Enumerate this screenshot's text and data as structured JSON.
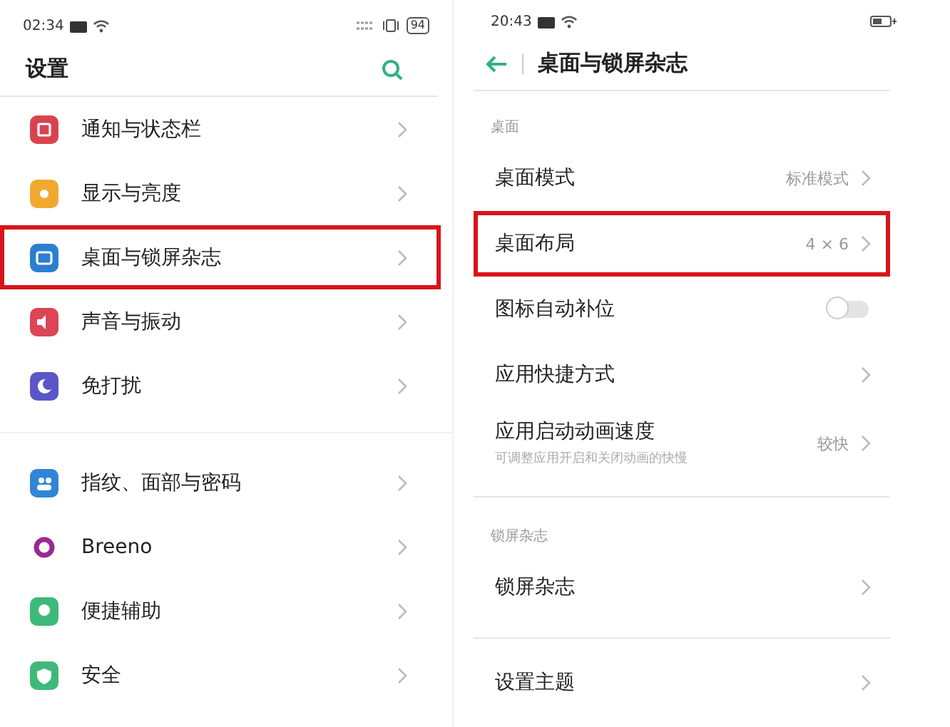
{
  "left": {
    "status_bar": {
      "time": "02:34",
      "battery": "94"
    },
    "title": "设置",
    "groups": [
      {
        "items": [
          {
            "label": "通知与状态栏",
            "kind": "notification",
            "color": "#d9434f",
            "highlighted": false
          },
          {
            "label": "显示与亮度",
            "kind": "sun",
            "color": "#f0a830",
            "highlighted": false
          },
          {
            "label": "桌面与锁屏杂志",
            "kind": "desktop",
            "color": "#2b7fd0",
            "highlighted": true
          },
          {
            "label": "声音与振动",
            "kind": "sound",
            "color": "#dd4455",
            "highlighted": false
          },
          {
            "label": "免打扰",
            "kind": "moon",
            "color": "#5a56c8",
            "highlighted": false
          }
        ]
      },
      {
        "items": [
          {
            "label": "指纹、面部与密码",
            "kind": "people",
            "color": "#2f86d6",
            "highlighted": false
          },
          {
            "label": "Breeno",
            "kind": "ring",
            "color": "#9a2a8e",
            "highlighted": false
          },
          {
            "label": "便捷辅助",
            "kind": "hand",
            "color": "#3fb97a",
            "highlighted": false
          },
          {
            "label": "安全",
            "kind": "shield",
            "color": "#3fb97a",
            "highlighted": false
          }
        ]
      }
    ]
  },
  "right": {
    "status_bar": {
      "time": "20:43"
    },
    "title": "桌面与锁屏杂志",
    "sections": [
      {
        "label": "桌面",
        "rows": [
          {
            "kind": "link",
            "label": "桌面模式",
            "value": "标准模式",
            "highlighted": false
          },
          {
            "kind": "link",
            "label": "桌面布局",
            "value": "4 × 6",
            "highlighted": true
          },
          {
            "kind": "toggle",
            "label": "图标自动补位",
            "on": false,
            "highlighted": false
          },
          {
            "kind": "link",
            "label": "应用快捷方式",
            "highlighted": false
          },
          {
            "kind": "link",
            "label": "应用启动动画速度",
            "subtitle": "可调整应用开启和关闭动画的快慢",
            "value": "较快",
            "highlighted": false
          }
        ]
      },
      {
        "label": "锁屏杂志",
        "rows": [
          {
            "kind": "link",
            "label": "锁屏杂志",
            "highlighted": false
          }
        ]
      },
      {
        "rows": [
          {
            "kind": "link",
            "label": "设置主题",
            "highlighted": false
          }
        ]
      }
    ]
  }
}
